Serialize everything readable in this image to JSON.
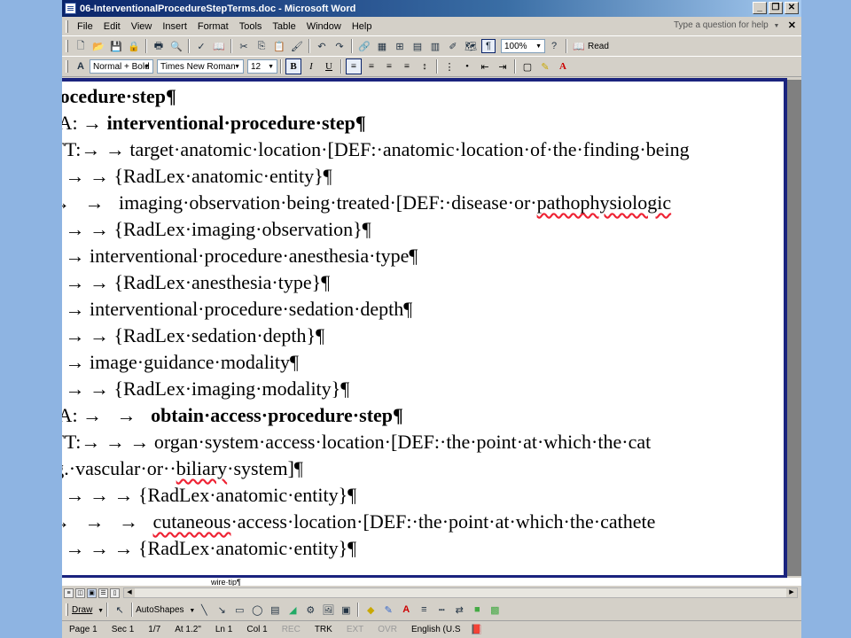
{
  "window": {
    "title": "06-InterventionalProcedureStepTerms.doc - Microsoft Word"
  },
  "menu": {
    "items": [
      "File",
      "Edit",
      "View",
      "Insert",
      "Format",
      "Tools",
      "Table",
      "Window",
      "Help"
    ],
    "help_box": "Type a question for help"
  },
  "standard_toolbar": {
    "zoom": "100%",
    "read_label": "Read"
  },
  "format_toolbar": {
    "style": "Normal + Bold",
    "font": "Times New Roman",
    "size": "12"
  },
  "document": {
    "lines": [
      {
        "text": "procedure·step¶",
        "bold": true
      },
      {
        "text": "ISA: → interventional·procedure·step¶"
      },
      {
        "text": "ATT:→   →   target·anatomic·location·[DEF:·anatomic·location·of·the·finding·being"
      },
      {
        "text": "  →   →   →   {RadLex·anatomic·entity}¶"
      },
      {
        "text": "  →   →   imaging·observation·being·treated·[DEF:·disease·or·pathophysiologic"
      },
      {
        "text": "  →   →   →   {RadLex·imaging·observation}¶"
      },
      {
        "text": "  →   →   interventional·procedure·anesthesia·type¶"
      },
      {
        "text": "  →   →   →   {RadLex·anesthesia·type}¶"
      },
      {
        "text": "  →   →   interventional·procedure·sedation·depth¶"
      },
      {
        "text": "  →   →   →   {RadLex·sedation·depth}¶"
      },
      {
        "text": "  →   →   image·guidance·modality¶"
      },
      {
        "text": "  →   →   →   {RadLex·imaging·modality}¶"
      },
      {
        "text": "ISA: →   →   obtain·access·procedure·step¶"
      },
      {
        "text": "ATT:→   →   →   organ·system·access·location·[DEF:·the·point·at·which·the·cat"
      },
      {
        "text": "e.g.·vascular·or··biliary·system]¶"
      },
      {
        "text": "  →   →   →   →   {RadLex·anatomic·entity}¶"
      },
      {
        "text": "  →   →   →   cutaneous·access·location·[DEF:·the·point·at·which·the·cathete"
      },
      {
        "text": "  →   →   →   →   {RadLex·anatomic·entity}¶"
      }
    ],
    "below_text": "wire·tip¶"
  },
  "draw_toolbar": {
    "draw_label": "Draw",
    "autoshapes_label": "AutoShapes"
  },
  "status_bar": {
    "page": "Page 1",
    "sec": "Sec 1",
    "pages": "1/7",
    "at": "At 1.2\"",
    "ln": "Ln 1",
    "col": "Col 1",
    "rec": "REC",
    "trk": "TRK",
    "ext": "EXT",
    "ovr": "OVR",
    "lang": "English (U.S"
  },
  "colors": {
    "desktop": "#8eb4e2",
    "page_border": "#1a237e",
    "titlebar": "#0a246a"
  }
}
